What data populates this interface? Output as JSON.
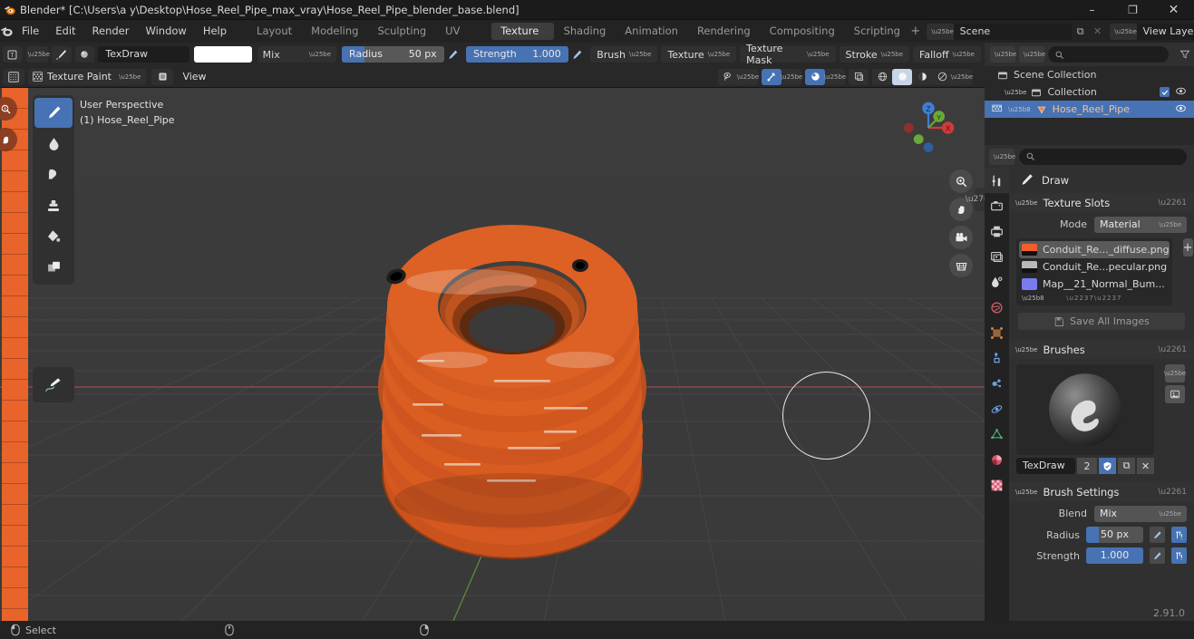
{
  "window": {
    "title": "Blender* [C:\\Users\\a y\\Desktop\\Hose_Reel_Pipe_max_vray\\Hose_Reel_Pipe_blender_base.blend]",
    "minimize": "–",
    "maximize": "❐",
    "close": "✕"
  },
  "menus": [
    "File",
    "Edit",
    "Render",
    "Window",
    "Help"
  ],
  "workspace_tabs": [
    {
      "label": "Layout",
      "active": false
    },
    {
      "label": "Modeling",
      "active": false
    },
    {
      "label": "Sculpting",
      "active": false
    },
    {
      "label": "UV Editing",
      "active": false
    },
    {
      "label": "Texture Paint",
      "active": true
    },
    {
      "label": "Shading",
      "active": false
    },
    {
      "label": "Animation",
      "active": false
    },
    {
      "label": "Rendering",
      "active": false
    },
    {
      "label": "Compositing",
      "active": false
    },
    {
      "label": "Scripting",
      "active": false
    }
  ],
  "workspace_add": "+",
  "scene": {
    "name": "Scene",
    "new_label": "⧉",
    "close_label": "✕"
  },
  "view_layer": {
    "name": "View Layer",
    "new_label": "⧉",
    "close_label": "✕"
  },
  "tool_header": {
    "brush_name": "TexDraw",
    "color_swatch": "#ffffff",
    "blend_mode": "Mix",
    "radius_label": "Radius",
    "radius_value": "50 px",
    "radius_fill_pct": 22,
    "strength_label": "Strength",
    "strength_value": "1.000",
    "strength_fill_pct": 100,
    "popovers": [
      "Brush",
      "Texture",
      "Texture Mask",
      "Stroke",
      "Falloff"
    ]
  },
  "viewport_header": {
    "mode": "Texture Paint",
    "menus": [
      "View"
    ]
  },
  "viewport": {
    "perspective": "User Perspective",
    "object_line": "(1) Hose_Reel_Pipe",
    "gizmo_axes": [
      "Z",
      "Y",
      "X"
    ],
    "background": "#3a3a3a"
  },
  "left_toolbar": [
    {
      "name": "draw-tool",
      "active": true
    },
    {
      "name": "soften-tool",
      "active": false
    },
    {
      "name": "smear-tool",
      "active": false
    },
    {
      "name": "clone-tool",
      "active": false
    },
    {
      "name": "fill-tool",
      "active": false
    },
    {
      "name": "mask-tool",
      "active": false
    }
  ],
  "left_toolbar2": [
    {
      "name": "annotate-tool",
      "active": false
    }
  ],
  "outliner": {
    "display_mode": "View Layer",
    "search_placeholder": "",
    "rows": [
      {
        "label": "Scene Collection",
        "indent": 0,
        "selected": false,
        "icon": "collection-icon",
        "has_check": false,
        "has_eye": false
      },
      {
        "label": "Collection",
        "indent": 1,
        "selected": false,
        "icon": "collection-icon",
        "has_check": true,
        "has_eye": true
      },
      {
        "label": "Hose_Reel_Pipe",
        "indent": 2,
        "selected": true,
        "icon": "mesh-icon",
        "has_check": false,
        "has_eye": true
      }
    ]
  },
  "properties": {
    "search_placeholder": "",
    "tool_title": "Draw",
    "panels": {
      "texture_slots": {
        "title": "Texture Slots",
        "mode_label": "Mode",
        "mode_value": "Material",
        "add_label": "+",
        "slots": [
          {
            "name": "Conduit_Re..._diffuse.png",
            "color": "#f2602a",
            "selected": true
          },
          {
            "name": "Conduit_Re...pecular.png",
            "color": "#b9b9b9",
            "selected": false
          },
          {
            "name": "Map__21_Normal_Bum...",
            "color": "#7b7bf0",
            "selected": false
          }
        ],
        "save_all_label": "Save All Images"
      },
      "brushes": {
        "title": "Brushes",
        "brush_name": "TexDraw",
        "users_count": "2",
        "fake_user_label": "✓",
        "duplicate_label": "⧉",
        "unlink_label": "✕"
      },
      "brush_settings": {
        "title": "Brush Settings",
        "blend_label": "Blend",
        "blend_value": "Mix",
        "radius_label": "Radius",
        "radius_value": "50 px",
        "radius_fill_pct": 22,
        "strength_label": "Strength",
        "strength_value": "1.000",
        "strength_fill_pct": 100
      }
    },
    "version": "2.91.0"
  },
  "statusbar": {
    "select_label": "Select",
    "items": [
      "Select",
      "",
      ""
    ]
  }
}
